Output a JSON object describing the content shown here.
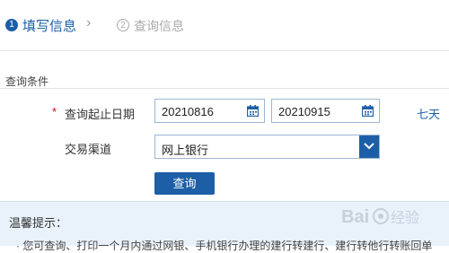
{
  "steps": {
    "step1": {
      "number": "1",
      "label": "填写信息"
    },
    "arrow": "›",
    "step2": {
      "number": "2",
      "label": "查询信息"
    }
  },
  "form": {
    "section_title": "查询条件",
    "required_mark": "*",
    "date_label": "查询起止日期",
    "start_date": "20210816",
    "end_date": "20210915",
    "quick_range": "七天",
    "channel_label": "交易渠道",
    "channel_value": "网上银行",
    "query_button": "查询"
  },
  "tips": {
    "title": "温馨提示：",
    "text": "· 您可查询、打印一个月内通过网银、手机银行办理的建行转建行、建行转他行转账回单"
  },
  "watermark": {
    "text": "Bai 经验"
  },
  "colors": {
    "primary": "#1d5fa7",
    "required": "#d0021b",
    "tips_background": "#e9f2fb"
  },
  "icons": [
    "calendar-icon",
    "chevron-down-icon"
  ]
}
